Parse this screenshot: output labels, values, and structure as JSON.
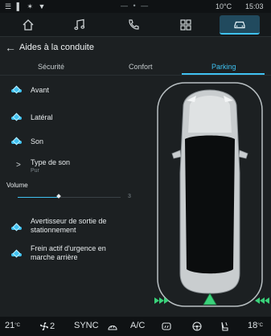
{
  "statusbar": {
    "left_icons": "☰ ▌ ✶ ▼",
    "center": "— • —",
    "temperature": "10°C",
    "time": "15:03"
  },
  "navbar": {
    "tabs": [
      {
        "icon": "home-icon"
      },
      {
        "icon": "music-icon"
      },
      {
        "icon": "phone-icon"
      },
      {
        "icon": "apps-icon"
      },
      {
        "icon": "car-icon",
        "active": true
      }
    ]
  },
  "header": {
    "back_label": "←",
    "title": "Aides à la conduite"
  },
  "tabs": [
    {
      "label": "Sécurité"
    },
    {
      "label": "Confort"
    },
    {
      "label": "Parking",
      "active": true
    }
  ],
  "settings": {
    "avant": {
      "label": "Avant",
      "enabled": true
    },
    "lateral": {
      "label": "Latéral",
      "enabled": true
    },
    "son": {
      "label": "Son",
      "enabled": true
    },
    "type_de_son": {
      "label": "Type de son",
      "value": "Pur",
      "chevron": ">"
    },
    "volume": {
      "label": "Volume",
      "value": "3",
      "level_fraction": 0.4
    },
    "avertisseur": {
      "label_line1": "Avertisseur de sortie de",
      "label_line2": "stationnement",
      "enabled": true
    },
    "frein": {
      "label_line1": "Frein actif d'urgence en",
      "label_line2": "marche arrière",
      "enabled": true
    }
  },
  "colors": {
    "accent": "#3fc2f2",
    "sensor_green": "#39d27a",
    "background": "#1c2022"
  },
  "bottombar": {
    "temp_left": "21",
    "temp_left_unit": "°C",
    "fan_level": "2",
    "sync": "SYNC",
    "ac": "A/C",
    "temp_right": "18",
    "temp_right_unit": "°C"
  }
}
